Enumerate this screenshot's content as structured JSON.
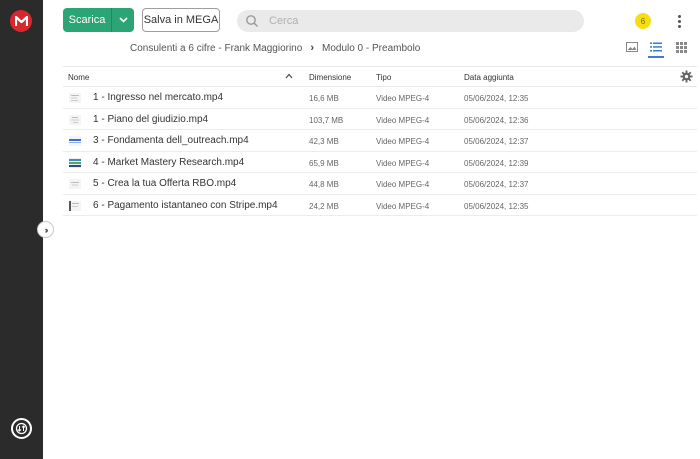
{
  "toolbar": {
    "download_label": "Scarica",
    "save_label": "Salva in MEGA",
    "search_placeholder": "Cerca",
    "notification_count": "6"
  },
  "breadcrumb": {
    "parent": "Consulenti a 6 cifre - Frank Maggiorino",
    "current": "Modulo 0 - Preambolo"
  },
  "table": {
    "headers": {
      "name": "Nome",
      "size": "Dimensione",
      "type": "Tipo",
      "date": "Data aggiunta"
    },
    "rows": [
      {
        "name": "1 - Ingresso nel mercato.mp4",
        "size": "16,6 MB",
        "type": "Video MPEG-4",
        "date": "05/06/2024, 12:35",
        "thumb": "doc"
      },
      {
        "name": "1 - Piano del giudizio.mp4",
        "size": "103,7 MB",
        "type": "Video MPEG-4",
        "date": "05/06/2024, 12:36",
        "thumb": "doc"
      },
      {
        "name": "3 - Fondamenta dell_outreach.mp4",
        "size": "42,3 MB",
        "type": "Video MPEG-4",
        "date": "05/06/2024, 12:37",
        "thumb": "blue"
      },
      {
        "name": "4 - Market Mastery Research.mp4",
        "size": "65,9 MB",
        "type": "Video MPEG-4",
        "date": "05/06/2024, 12:39",
        "thumb": "mixed"
      },
      {
        "name": "5 - Crea la tua Offerta RBO.mp4",
        "size": "44,8 MB",
        "type": "Video MPEG-4",
        "date": "05/06/2024, 12:37",
        "thumb": "doc"
      },
      {
        "name": "6 - Pagamento istantaneo con Stripe.mp4",
        "size": "24,2 MB",
        "type": "Video MPEG-4",
        "date": "05/06/2024, 12:35",
        "thumb": "dark"
      }
    ]
  },
  "colors": {
    "sidebar": "#2b2b2b",
    "logo": "#d9272e",
    "download_button": "#2ba575",
    "badge": "#f5de14",
    "active_view": "#3a7bd5"
  }
}
